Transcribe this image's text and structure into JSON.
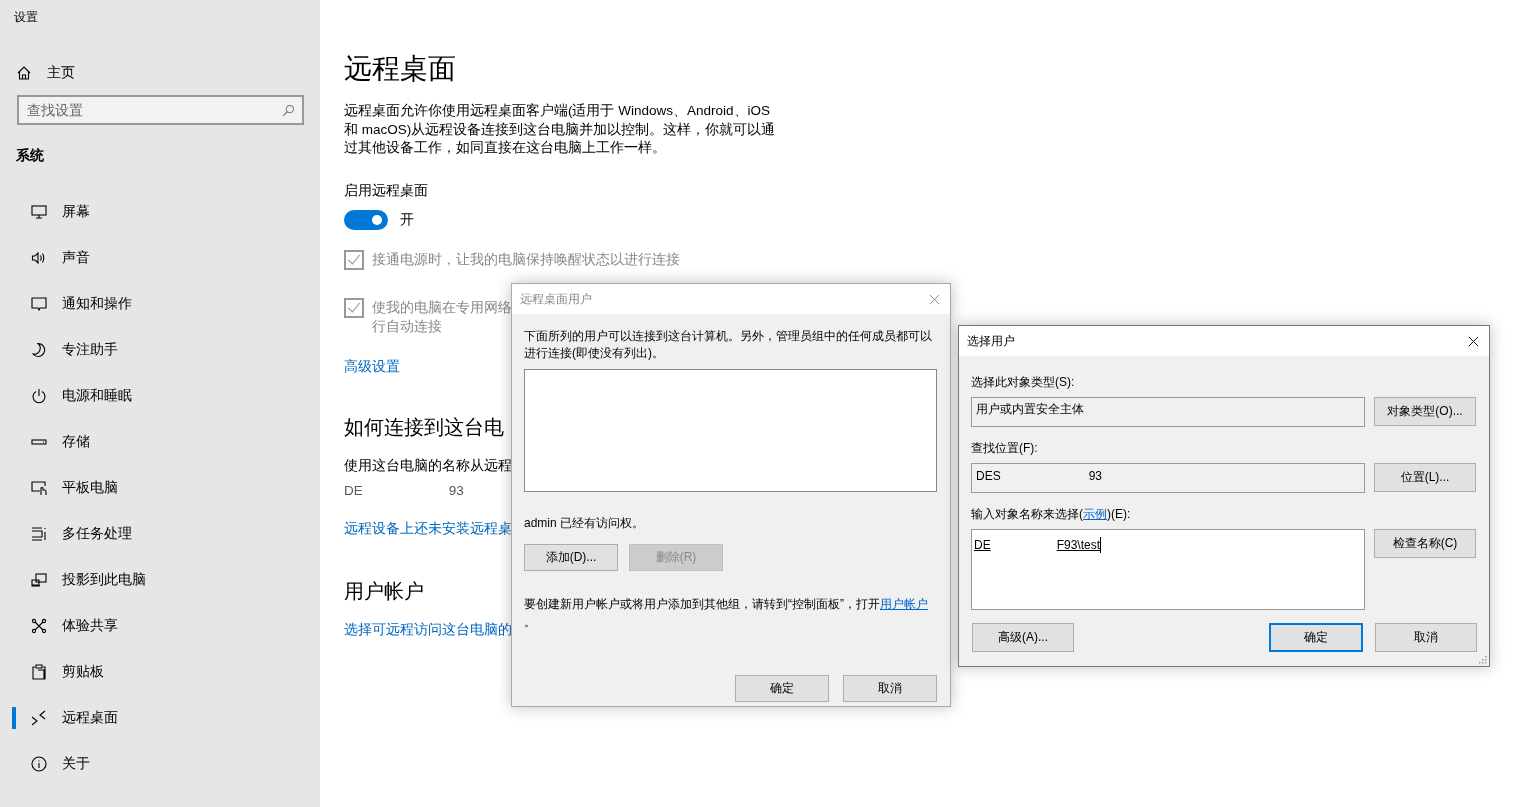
{
  "window": {
    "title": "设置"
  },
  "sidebar": {
    "home": "主页",
    "search": {
      "placeholder": "查找设置"
    },
    "section": "系统",
    "items": [
      {
        "label": "屏幕",
        "selected": false
      },
      {
        "label": "声音",
        "selected": false
      },
      {
        "label": "通知和操作",
        "selected": false
      },
      {
        "label": "专注助手",
        "selected": false
      },
      {
        "label": "电源和睡眠",
        "selected": false
      },
      {
        "label": "存储",
        "selected": false
      },
      {
        "label": "平板电脑",
        "selected": false
      },
      {
        "label": "多任务处理",
        "selected": false
      },
      {
        "label": "投影到此电脑",
        "selected": false
      },
      {
        "label": "体验共享",
        "selected": false
      },
      {
        "label": "剪贴板",
        "selected": false
      },
      {
        "label": "远程桌面",
        "selected": true
      },
      {
        "label": "关于",
        "selected": false
      }
    ]
  },
  "page": {
    "title": "远程桌面",
    "description": "远程桌面允许你使用远程桌面客户端(适用于 Windows、Android、iOS 和 macOS)从远程设备连接到这台电脑并加以控制。这样，你就可以通过其他设备工作，如同直接在这台电脑上工作一样。",
    "enable": {
      "label": "启用远程桌面",
      "on": true,
      "state_text": "开"
    },
    "options": [
      {
        "lines": [
          "接通电源时，让我的电脑保持唤醒状态以进行连接"
        ],
        "checked": true,
        "disabled": true
      },
      {
        "lines": [
          "使我的电脑在专用网络",
          "行自动连接"
        ],
        "checked": true,
        "disabled": true
      }
    ],
    "advanced_link": "高级设置",
    "connect_section": {
      "title": "如何连接到这台电",
      "text": "使用这台电脑的名称从远程",
      "pc_name": [
        "DE",
        "93"
      ],
      "link": "远程设备上还未安装远程桌"
    },
    "accounts_section": {
      "title": "用户帐户",
      "link": "选择可远程访问这台电脑的"
    }
  },
  "remote_users_dialog": {
    "title": "远程桌面用户",
    "active": false,
    "description": "下面所列的用户可以连接到这台计算机。另外，管理员组中的任何成员都可以进行连接(即使没有列出)。",
    "status": "admin 已经有访问权。",
    "buttons": [
      {
        "label": "添加(D)...",
        "disabled": false
      },
      {
        "label": "删除(R)",
        "disabled": true
      }
    ],
    "note": "要创建新用户帐户或将用户添加到其他组，请转到“控制面板”，打开",
    "note_link": "用户帐户",
    "note_end": "。",
    "ok": "确定",
    "cancel": "取消"
  },
  "select_users_dialog": {
    "title": "选择用户",
    "active": true,
    "type_label": "选择此对象类型(S):",
    "type_value": "用户或内置安全主体",
    "type_button": "对象类型(O)...",
    "location_label": "查找位置(F):",
    "location_value": [
      "DES",
      "93"
    ],
    "location_button": "位置(L)...",
    "name_label_start": "输入对象名称来选择(",
    "name_label_link": "示例",
    "name_label_end": ")(E):",
    "name_value": [
      "DE",
      "F93\\test"
    ],
    "check_button": "检查名称(C)",
    "advanced_button": "高级(A)...",
    "ok": "确定",
    "cancel": "取消"
  }
}
